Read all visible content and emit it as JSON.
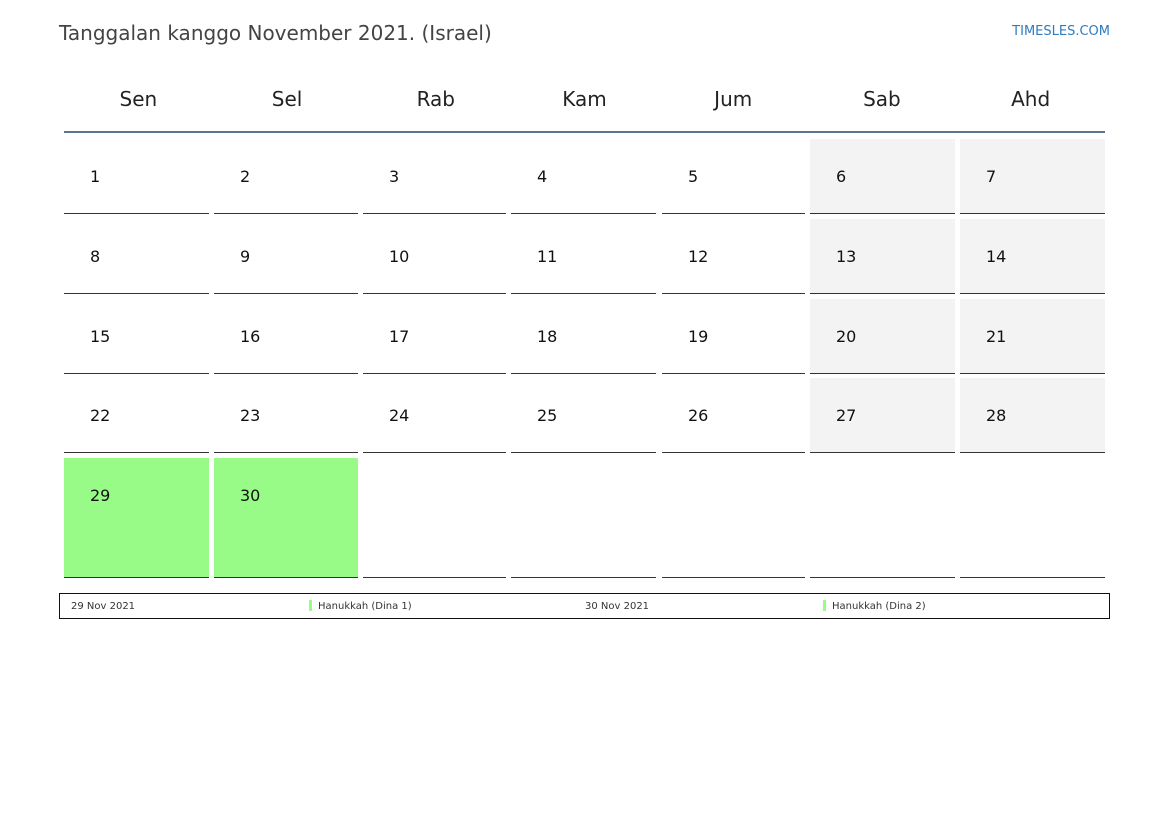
{
  "header": {
    "title": "Tanggalan kanggo November 2021. (Israel)",
    "site": "TIMESLES.COM"
  },
  "weekdays": [
    "Sen",
    "Sel",
    "Rab",
    "Kam",
    "Jum",
    "Sab",
    "Ahd"
  ],
  "days": [
    "1",
    "2",
    "3",
    "4",
    "5",
    "6",
    "7",
    "8",
    "9",
    "10",
    "11",
    "12",
    "13",
    "14",
    "15",
    "16",
    "17",
    "18",
    "19",
    "20",
    "21",
    "22",
    "23",
    "24",
    "25",
    "26",
    "27",
    "28",
    "29",
    "30"
  ],
  "colors": {
    "holiday": "#99fb87",
    "weekend": "#f3f3f3",
    "link": "#2f7bbf",
    "header_rule": "#5a7493"
  },
  "legend": [
    {
      "date": "29 Nov 2021",
      "event": "Hanukkah (Dina 1)"
    },
    {
      "date": "30 Nov 2021",
      "event": "Hanukkah (Dina 2)"
    }
  ]
}
